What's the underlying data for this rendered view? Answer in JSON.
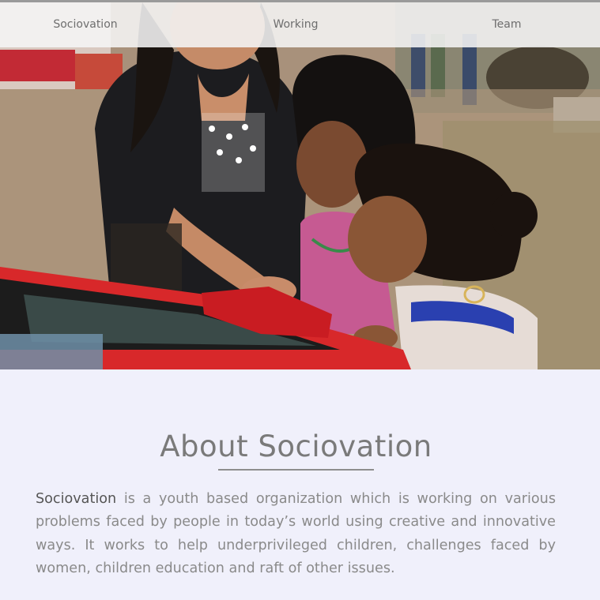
{
  "nav": {
    "items": [
      {
        "label": "Sociovation"
      },
      {
        "label": "Working"
      },
      {
        "label": "Team"
      }
    ]
  },
  "hero": {
    "image_alt": "woman and two girls using an interactive red kiosk"
  },
  "about": {
    "title": "About Sociovation",
    "brand": "Sociovation",
    "body": " is a youth based organization which is working on various problems faced by people in today’s world using creative and innovative ways. It works to help underprivileged children, challenges faced by women, children education and raft of other issues."
  },
  "colors": {
    "page_background": "#f0f0fb",
    "nav_text": "#6e6e6e",
    "title_text": "#7a7a7a",
    "body_text": "#8a8a8a",
    "kiosk_red": "#d8282a"
  }
}
